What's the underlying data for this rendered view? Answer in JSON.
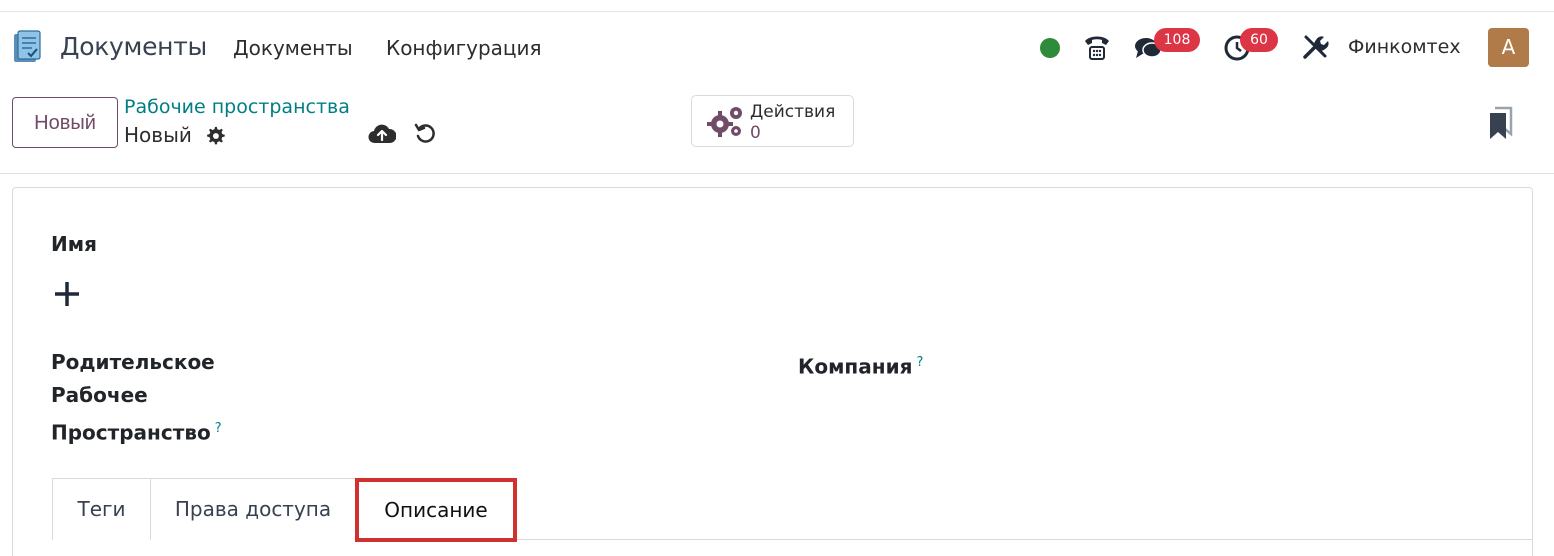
{
  "navbar": {
    "app_title": "Документы",
    "menu": [
      "Документы",
      "Конфигурация"
    ],
    "status_color": "#2e8b3a",
    "chat_badge": "108",
    "activity_badge": "60",
    "company": "Финкомтех",
    "avatar_letter": "A",
    "icons": [
      "documents-app-icon",
      "phone-icon",
      "chat-icon",
      "clock-icon",
      "tools-icon"
    ]
  },
  "control_panel": {
    "new_button": "Новый",
    "breadcrumb": "Рабочие пространства",
    "record_name": "Новый",
    "actions_label": "Действия",
    "actions_count": "0"
  },
  "form": {
    "name_label": "Имя",
    "parent_label_lines": [
      "Родительское",
      "Рабочее",
      "Пространство"
    ],
    "company_label": "Компания",
    "help_mark": "?",
    "tabs": [
      "Теги",
      "Права доступа",
      "Описание"
    ],
    "highlighted_tab": "Описание",
    "highlight_color": "#d0312d"
  },
  "colors": {
    "brand": "#714b67",
    "link": "#017e84",
    "badge": "#dc3545",
    "avatar": "#b07b48"
  }
}
